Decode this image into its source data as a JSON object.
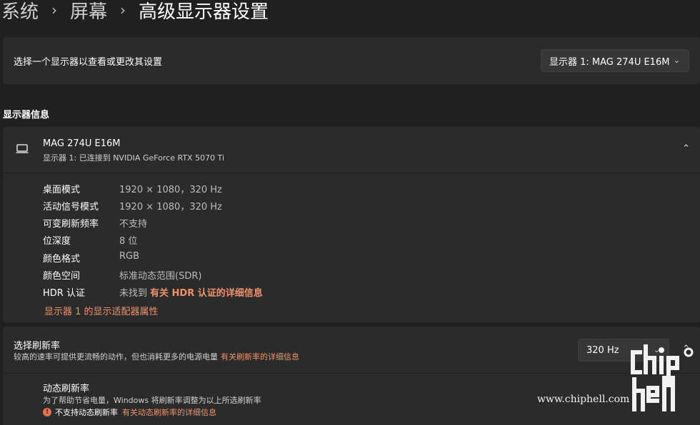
{
  "breadcrumb": {
    "items": [
      "系统",
      "屏幕",
      "高级显示器设置"
    ]
  },
  "display_select": {
    "label": "选择一个显示器以查看或更改其设置",
    "selected": "显示器 1: MAG 274U E16M"
  },
  "display_info": {
    "section_title": "显示器信息",
    "name": "MAG 274U E16M",
    "subtitle": "显示器 1: 已连接到 NVIDIA GeForce RTX 5070 Ti",
    "icon": "monitor-icon",
    "rows": [
      {
        "key": "桌面模式",
        "value": "1920 × 1080，320 Hz"
      },
      {
        "key": "活动信号模式",
        "value": "1920 × 1080，320 Hz"
      },
      {
        "key": "可变刷新频率",
        "value": "不支持"
      },
      {
        "key": "位深度",
        "value": "8 位"
      },
      {
        "key": "颜色格式",
        "value": "RGB"
      },
      {
        "key": "颜色空间",
        "value": "标准动态范围(SDR)"
      },
      {
        "key": "HDR 认证",
        "value": "未找到",
        "link": "有关 HDR 认证的详细信息"
      }
    ],
    "adapter_link": "显示器 1 的显示适配器属性"
  },
  "refresh_rate": {
    "title": "选择刷新率",
    "description": "较高的速率可提供更流畅的动作，但也消耗更多的电源电量",
    "link": "有关刷新率的详细信息",
    "selected": "320 Hz"
  },
  "dynamic_refresh": {
    "title": "动态刷新率",
    "description": "为了帮助节省电量，Windows 将刷新率调整为以上所选刷新率",
    "warning": "不支持动态刷新率",
    "link": "有关动态刷新率的详细信息"
  },
  "watermark": {
    "url": "www.chiphell.com",
    "logo": "chiphell"
  },
  "colors": {
    "background": "#202020",
    "card": "#2b2b2b",
    "accent_link": "#f0926b",
    "warning": "#e8704a"
  }
}
